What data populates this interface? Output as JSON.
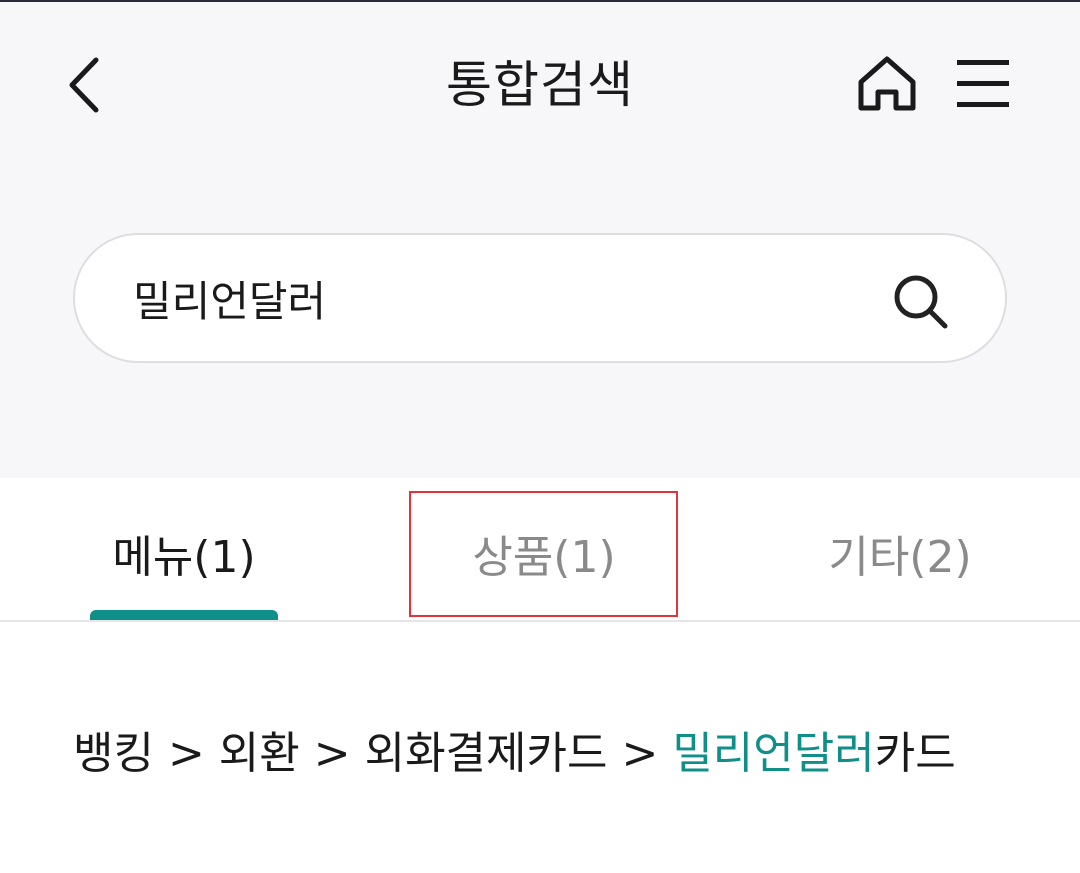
{
  "header": {
    "title": "통합검색",
    "back_icon": "chevron-left-icon",
    "home_icon": "home-icon",
    "menu_icon": "hamburger-menu-icon"
  },
  "search": {
    "value": "밀리언달러",
    "icon": "search-icon"
  },
  "tabs": [
    {
      "label": "메뉴(1)",
      "active": true
    },
    {
      "label": "상품(1)",
      "active": false
    },
    {
      "label": "기타(2)",
      "active": false
    }
  ],
  "results": [
    {
      "prefix": "뱅킹 > 외환 > 외화결제카드 > ",
      "keyword": "밀리언달러",
      "suffix": "카드"
    }
  ],
  "colors": {
    "accent": "#0f8f88",
    "highlight_border": "#e3343a",
    "header_bg": "#f7f7f9"
  }
}
